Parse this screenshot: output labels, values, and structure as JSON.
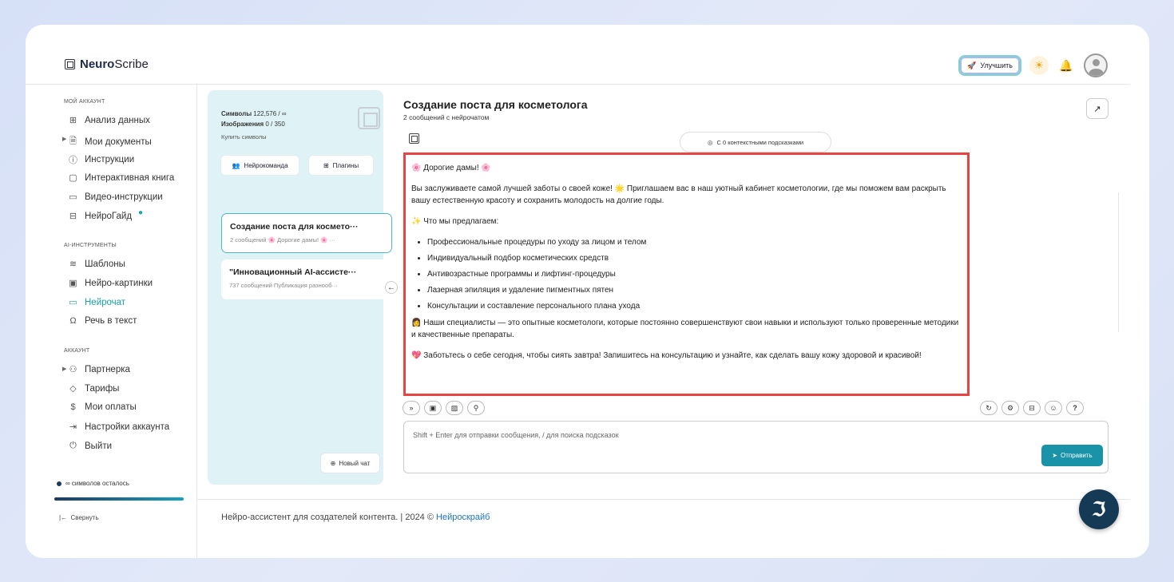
{
  "app": {
    "logo_bold": "Neuro",
    "logo_rest": "Scribe"
  },
  "header": {
    "upgrade_label": "Улучшить"
  },
  "sidebar": {
    "section_account": "МОЙ АККАУНТ",
    "items_account": [
      "Анализ данных",
      "Мои документы",
      "Инструкции",
      "Интерактивная книга",
      "Видео-инструкции",
      "НейроГайд"
    ],
    "section_tools": "AI-ИНСТРУМЕНТЫ",
    "items_tools": [
      "Шаблоны",
      "Нейро-картинки",
      "Нейрочат",
      "Речь в текст"
    ],
    "section_acc2": "АККАУНТ",
    "items_acc2": [
      "Партнерка",
      "Тарифы",
      "Мои оплаты",
      "Настройки аккаунта",
      "Выйти"
    ],
    "symbols_left": "∞ символов осталось",
    "collapse": "Свернуть"
  },
  "panel": {
    "symbols_label": "Символы",
    "symbols_value": "122,576 / ∞",
    "images_label": "Изображения",
    "images_value": "0 / 350",
    "buy": "Купить символы",
    "team_btn": "Нейрокоманда",
    "plugins_btn": "Плагины",
    "chats": [
      {
        "title": "Создание поста для космето···",
        "sub": "2 сообщений   🌸 Дорогие дамы! 🌸 ···"
      },
      {
        "title": "\"Инновационный AI-ассисте···",
        "sub": "737 сообщений Публикация разнооб···"
      }
    ],
    "new_chat": "Новый чат"
  },
  "main": {
    "title": "Создание поста для косметолога",
    "subtitle": "2 сообщений с нейрочатом",
    "context_hint": "С 0 контекстными подсказками",
    "message": {
      "greeting": "🌸 Дорогие дамы! 🌸",
      "intro": "Вы заслуживаете самой лучшей заботы о своей коже! 🌟 Приглашаем вас в наш уютный кабинет косметологии, где мы поможем вам раскрыть вашу естественную красоту и сохранить молодость на долгие годы.",
      "offer_heading": "✨ Что мы предлагаем:",
      "offers": [
        "Профессиональные процедуры по уходу за лицом и телом",
        "Индивидуальный подбор косметических средств",
        "Антивозрастные программы и лифтинг-процедуры",
        "Лазерная эпиляция и удаление пигментных пятен",
        "Консультации и составление персонального плана ухода"
      ],
      "specialists": "👩 Наши специалисты — это опытные косметологи, которые постоянно совершенствуют свои навыки и используют только проверенные методики и качественные препараты.",
      "cta": "💖 Заботьтесь о себе сегодня, чтобы сиять завтра! Запишитесь на консультацию и узнайте, как сделать вашу кожу здоровой и красивой!"
    },
    "input_placeholder": "Shift + Enter для отправки сообщения, / для поиска подсказок",
    "send_label": "Отправить"
  },
  "footer": {
    "text": "Нейро-ассистент для создателей контента.  | 2024 © ",
    "link": "Нейроскрайб"
  },
  "colors": {
    "accent": "#1a92a8",
    "highlight": "#e84444",
    "panel_bg": "#dff3f6"
  }
}
